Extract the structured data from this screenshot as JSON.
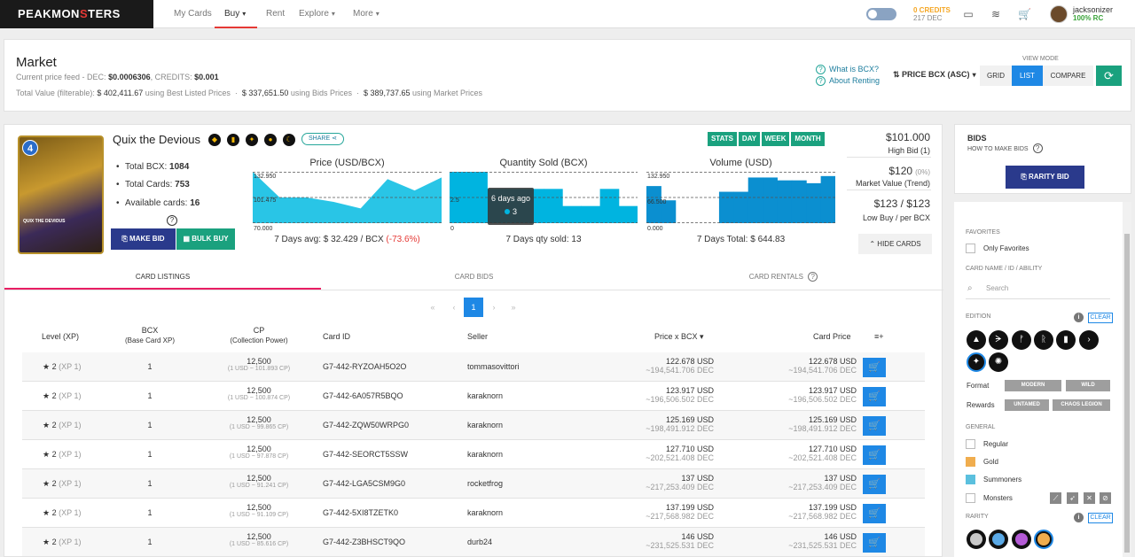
{
  "nav": {
    "logo_left": "PEAKMON",
    "logo_mid": "S",
    "logo_right": "TERS",
    "links": [
      "My Cards",
      "Buy",
      "Rent",
      "Explore",
      "More"
    ],
    "credits": "0 CREDITS",
    "dec": "217 DEC",
    "username": "jacksonizer",
    "rc": "100% RC"
  },
  "market": {
    "title": "Market",
    "price_feed_label": "Current price feed - DEC:",
    "dec_price": "$0.0006306",
    "credits_label": ", CREDITS:",
    "credits_price": "$0.001",
    "total_label": "Total Value (filterable):",
    "total_listed": "$ 402,411.67",
    "listed_label": "using Best Listed Prices",
    "total_bids": "$ 337,651.50",
    "bids_label": "using Bids Prices",
    "total_market": "$ 389,737.65",
    "market_label": "using Market Prices",
    "what_is_bcx": "What is BCX?",
    "about_renting": "About Renting",
    "sort": "PRICE BCX (ASC)",
    "viewmode_label": "VIEW MODE",
    "viewmodes": [
      "GRID",
      "LIST",
      "COMPARE"
    ]
  },
  "card": {
    "name": "Quix the Devious",
    "level": "4",
    "image_name": "QUIX THE DEVIOUS",
    "share": "SHARE",
    "total_bcx_label": "Total BCX:",
    "total_bcx": "1084",
    "total_cards_label": "Total Cards:",
    "total_cards": "753",
    "available_label": "Available cards:",
    "available": "16",
    "make_bid": "MAKE BID",
    "bulk_buy": "BULK BUY",
    "timeframes": [
      "STATS",
      "DAY",
      "WEEK",
      "MONTH"
    ],
    "high_bid": "$101.000",
    "high_bid_label": "High Bid (1)",
    "market_value": "$120",
    "market_value_pct": "(0%)",
    "market_value_label": "Market Value (Trend)",
    "low_buy": "$123 / $123",
    "low_buy_label": "Low Buy / per BCX",
    "hide_cards": "HIDE CARDS"
  },
  "charts": {
    "price_title": "Price (USD/BCX)",
    "price_footer_label": "7 Days avg:",
    "price_footer_value": "$ 32.429",
    "price_footer_unit": "/ BCX",
    "price_footer_change": "(-73.6%)",
    "qty_title": "Quantity Sold (BCX)",
    "qty_footer_label": "7 Days qty sold:",
    "qty_footer_value": "13",
    "tooltip_date": "6 days ago",
    "tooltip_value": "3",
    "vol_title": "Volume (USD)",
    "vol_footer_label": "7 Days Total:",
    "vol_footer_value": "$ 644.83"
  },
  "chart_data": [
    {
      "type": "area",
      "title": "Price (USD/BCX)",
      "tick_labels": [
        "132.950",
        "101.475",
        "70.000"
      ],
      "ylim": [
        70.0,
        132.95
      ],
      "values": [
        132.95,
        101.48,
        101.48,
        96.0,
        88.0,
        124.0,
        110.0,
        126.0
      ]
    },
    {
      "type": "bar",
      "title": "Quantity Sold (BCX)",
      "tick_labels": [
        "2.5",
        "0"
      ],
      "ylim": [
        0,
        3
      ],
      "values": [
        3,
        3,
        2,
        2,
        2,
        2,
        1,
        1,
        2,
        1
      ]
    },
    {
      "type": "bar",
      "title": "Volume (USD)",
      "tick_labels": [
        "132.950",
        "66.500",
        "0.000"
      ],
      "ylim": [
        0,
        180
      ],
      "values": [
        130,
        80,
        0,
        0,
        0,
        110,
        110,
        160,
        160,
        150,
        150,
        140,
        165
      ]
    }
  ],
  "tabs": [
    "CARD LISTINGS",
    "CARD BIDS",
    "CARD RENTALS"
  ],
  "pagination": [
    "«",
    "‹",
    "1",
    "›",
    "»"
  ],
  "table": {
    "headers": {
      "level": "Level (XP)",
      "bcx": "BCX",
      "bcx_sub": "(Base Card XP)",
      "cp": "CP",
      "cp_sub": "(Collection Power)",
      "card_id": "Card ID",
      "seller": "Seller",
      "price_bcx": "Price x BCX",
      "card_price": "Card Price",
      "menu": "≡+"
    },
    "rows": [
      {
        "level": "2",
        "xp": "(XP 1)",
        "bcx": "1",
        "cp": "12,500",
        "cp_sub": "(1 USD ~ 101.893 CP)",
        "card_id": "G7-442-RYZOAH5O2O",
        "seller": "tommasovittori",
        "price_usd": "122.678 USD",
        "price_dec": "~194,541.706 DEC",
        "card_usd": "122.678 USD",
        "card_dec": "~194,541.706 DEC"
      },
      {
        "level": "2",
        "xp": "(XP 1)",
        "bcx": "1",
        "cp": "12,500",
        "cp_sub": "(1 USD ~ 100.874 CP)",
        "card_id": "G7-442-6A057R5BQO",
        "seller": "karaknorn",
        "price_usd": "123.917 USD",
        "price_dec": "~196,506.502 DEC",
        "card_usd": "123.917 USD",
        "card_dec": "~196,506.502 DEC"
      },
      {
        "level": "2",
        "xp": "(XP 1)",
        "bcx": "1",
        "cp": "12,500",
        "cp_sub": "(1 USD ~ 99.865 CP)",
        "card_id": "G7-442-ZQW50WRPG0",
        "seller": "karaknorn",
        "price_usd": "125.169 USD",
        "price_dec": "~198,491.912 DEC",
        "card_usd": "125.169 USD",
        "card_dec": "~198,491.912 DEC"
      },
      {
        "level": "2",
        "xp": "(XP 1)",
        "bcx": "1",
        "cp": "12,500",
        "cp_sub": "(1 USD ~ 97.878 CP)",
        "card_id": "G7-442-SEORCT5SSW",
        "seller": "karaknorn",
        "price_usd": "127.710 USD",
        "price_dec": "~202,521.408 DEC",
        "card_usd": "127.710 USD",
        "card_dec": "~202,521.408 DEC"
      },
      {
        "level": "2",
        "xp": "(XP 1)",
        "bcx": "1",
        "cp": "12,500",
        "cp_sub": "(1 USD ~ 91.241 CP)",
        "card_id": "G7-442-LGA5CSM9G0",
        "seller": "rocketfrog",
        "price_usd": "137 USD",
        "price_dec": "~217,253.409 DEC",
        "card_usd": "137 USD",
        "card_dec": "~217,253.409 DEC"
      },
      {
        "level": "2",
        "xp": "(XP 1)",
        "bcx": "1",
        "cp": "12,500",
        "cp_sub": "(1 USD ~ 91.109 CP)",
        "card_id": "G7-442-5XI8TZETK0",
        "seller": "karaknorn",
        "price_usd": "137.199 USD",
        "price_dec": "~217,568.982 DEC",
        "card_usd": "137.199 USD",
        "card_dec": "~217,568.982 DEC"
      },
      {
        "level": "2",
        "xp": "(XP 1)",
        "bcx": "1",
        "cp": "12,500",
        "cp_sub": "(1 USD ~ 85.616 CP)",
        "card_id": "G7-442-Z3BHSCT9QO",
        "seller": "durb24",
        "price_usd": "146 USD",
        "price_dec": "~231,525.531 DEC",
        "card_usd": "146 USD",
        "card_dec": "~231,525.531 DEC"
      }
    ]
  },
  "sidebar": {
    "bids_title": "BIDS",
    "how_to_bids": "HOW TO MAKE BIDS",
    "rarity_bid": "RARITY BID",
    "favorites_label": "FAVORITES",
    "only_favorites": "Only Favorites",
    "search_label": "CARD NAME / ID / ABILITY",
    "search_placeholder": "Search",
    "edition_label": "EDITION",
    "clear": "CLEAR",
    "format_label": "Format",
    "formats": [
      "MODERN",
      "WILD"
    ],
    "rewards_label": "Rewards",
    "rewards": [
      "UNTAMED",
      "CHAOS LEGION"
    ],
    "general_label": "GENERAL",
    "general": [
      "Regular",
      "Gold",
      "Summoners",
      "Monsters"
    ],
    "rarity_label": "RARITY",
    "colors": {
      "gold": "#f0ad4e",
      "summoners": "#5bc0de",
      "accent": "#1e88e5",
      "green": "#1aa17e"
    }
  }
}
